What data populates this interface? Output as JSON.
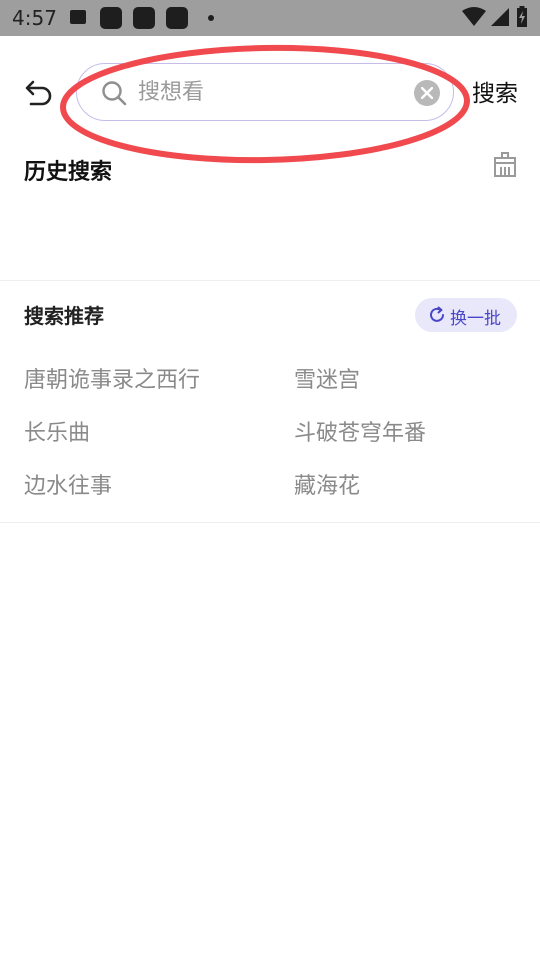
{
  "status_bar": {
    "time": "4:57"
  },
  "search": {
    "placeholder": "搜想看",
    "value": "",
    "button_label": "搜索"
  },
  "history": {
    "title": "历史搜索"
  },
  "recommendations": {
    "title": "搜索推荐",
    "refresh_label": "换一批",
    "items": [
      "唐朝诡事录之西行",
      "雪迷宫",
      "长乐曲",
      "斗破苍穹年番",
      "边水往事",
      "藏海花"
    ]
  },
  "colors": {
    "accent": "#4a46c9",
    "annotation_circle": "#f04a4f"
  }
}
